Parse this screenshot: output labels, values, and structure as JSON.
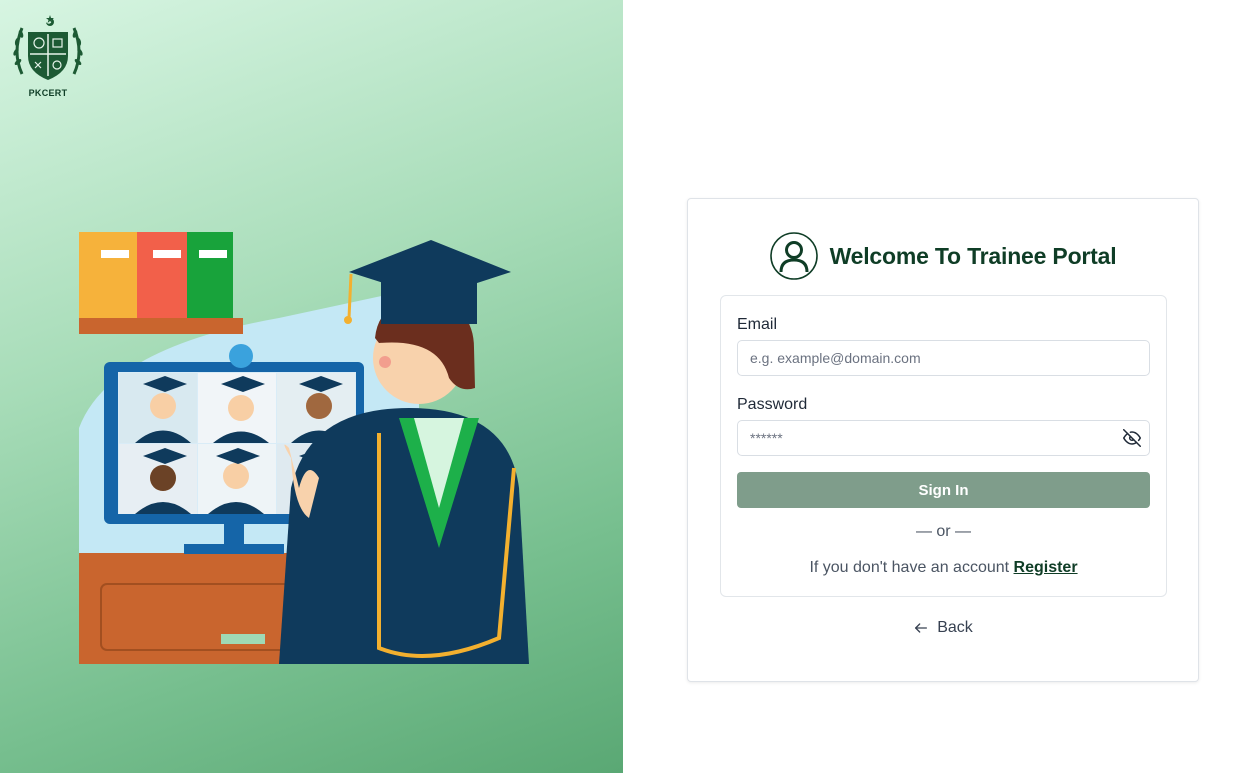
{
  "brand": {
    "logo_text": "PKCERT"
  },
  "login": {
    "title": "Welcome To Trainee Portal",
    "email_label": "Email",
    "email_placeholder": "e.g. example@domain.com",
    "password_label": "Password",
    "password_value": "******",
    "signin_label": "Sign In",
    "divider_text": "— or —",
    "register_prompt": "If you don't have an account ",
    "register_link": "Register",
    "back_label": "Back"
  },
  "icons": [
    "user-circle-icon",
    "eye-off-icon",
    "arrow-left-icon",
    "pkcert-emblem-icon"
  ],
  "colors": {
    "brand_dark_green": "#0f3d26",
    "signin_button": "#7f9d8b",
    "panel_gradient_start": "#d7f5e2",
    "panel_gradient_end": "#5aa874"
  }
}
